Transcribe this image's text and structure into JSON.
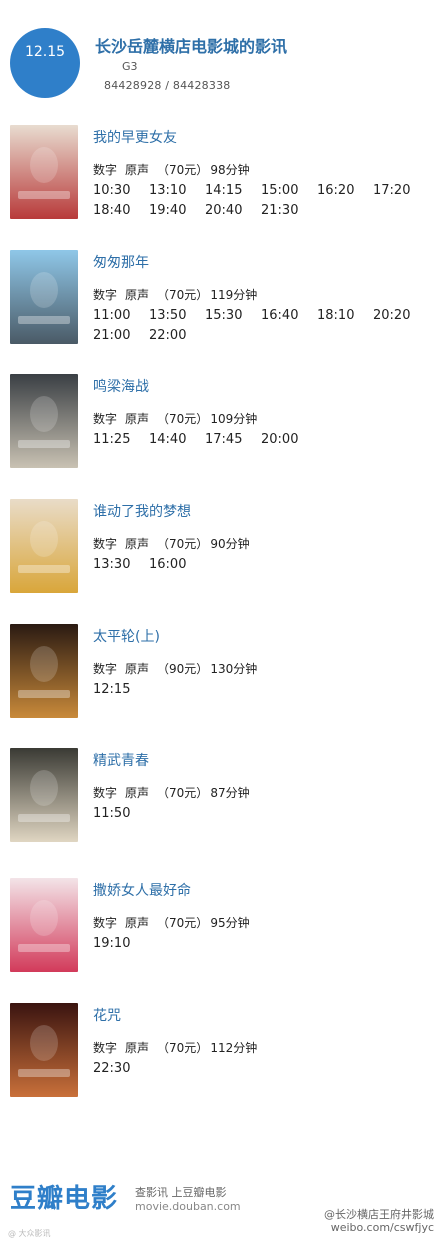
{
  "header": {
    "date": "12.15",
    "cinema_name": "长沙岳麓横店电影城的影讯",
    "code": "G3",
    "phone": "84428928 / 84428338"
  },
  "movies": [
    {
      "title": "我的早更女友",
      "format": "数字",
      "audio": "原声",
      "price": "（70元）",
      "duration": "98分钟",
      "times": [
        "10:30",
        "13:10",
        "14:15",
        "15:00",
        "16:20",
        "17:20",
        "18:40",
        "19:40",
        "20:40",
        "21:30"
      ],
      "poster_colors": [
        "#e8dcd0",
        "#b83a3a"
      ]
    },
    {
      "title": "匆匆那年",
      "format": "数字",
      "audio": "原声",
      "price": "（70元）",
      "duration": "119分钟",
      "times": [
        "11:00",
        "13:50",
        "15:30",
        "16:40",
        "18:10",
        "20:20",
        "21:00",
        "22:00"
      ],
      "poster_colors": [
        "#8fc7e8",
        "#4a5a66"
      ]
    },
    {
      "title": "鸣梁海战",
      "format": "数字",
      "audio": "原声",
      "price": "（70元）",
      "duration": "109分钟",
      "times": [
        "11:25",
        "14:40",
        "17:45",
        "20:00"
      ],
      "poster_colors": [
        "#3a3f44",
        "#c9c2b3"
      ]
    },
    {
      "title": "谁动了我的梦想",
      "format": "数字",
      "audio": "原声",
      "price": "（70元）",
      "duration": "90分钟",
      "times": [
        "13:30",
        "16:00"
      ],
      "poster_colors": [
        "#e9dcc8",
        "#d9a63a"
      ]
    },
    {
      "title": "太平轮(上)",
      "format": "数字",
      "audio": "原声",
      "price": "（90元）",
      "duration": "130分钟",
      "times": [
        "12:15"
      ],
      "poster_colors": [
        "#2a1a12",
        "#c98a3a"
      ]
    },
    {
      "title": "精武青春",
      "format": "数字",
      "audio": "原声",
      "price": "（70元）",
      "duration": "87分钟",
      "times": [
        "11:50"
      ],
      "poster_colors": [
        "#3a3a34",
        "#e0d6c2"
      ]
    },
    {
      "title": "撒娇女人最好命",
      "format": "数字",
      "audio": "原声",
      "price": "（70元）",
      "duration": "95分钟",
      "times": [
        "19:10"
      ],
      "poster_colors": [
        "#f3e4e8",
        "#d23a5a"
      ]
    },
    {
      "title": "花咒",
      "format": "数字",
      "audio": "原声",
      "price": "（70元）",
      "duration": "112分钟",
      "times": [
        "22:30"
      ],
      "poster_colors": [
        "#3a1410",
        "#c9703a"
      ]
    }
  ],
  "footer": {
    "brand": "豆瓣电影",
    "slogan": "查影讯 上豆瓣电影",
    "site": "movie.douban.com",
    "watermark_left": "@ 大众影讯",
    "watermark_right_1": "@长沙横店王府井影城",
    "watermark_right_2": "weibo.com/cswfjyc"
  },
  "colors": {
    "accent": "#2f7fc9",
    "title": "#2e6fa8"
  }
}
